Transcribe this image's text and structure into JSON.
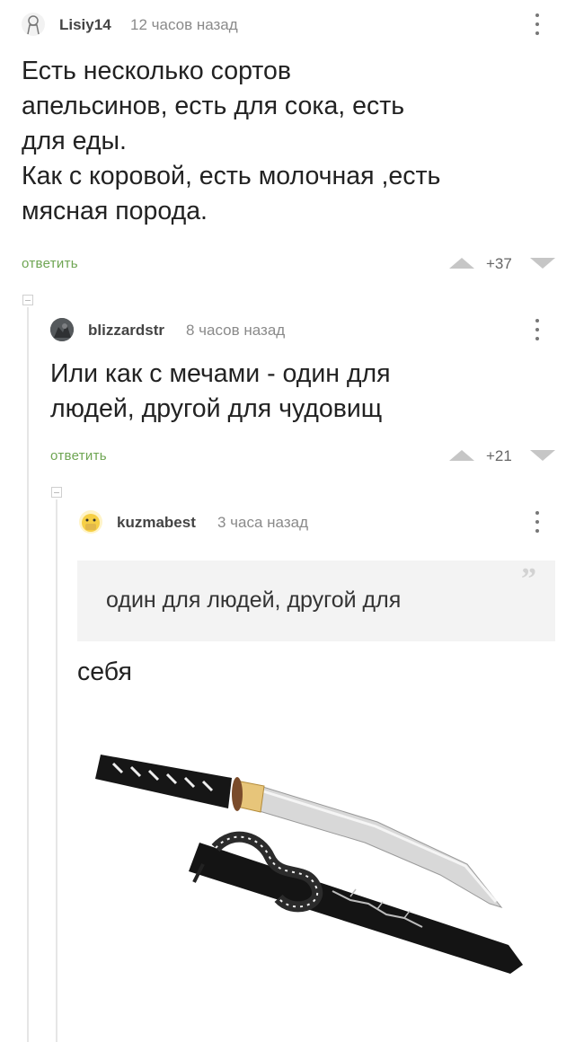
{
  "comments": [
    {
      "author": "Lisiy14",
      "time": "12 часов назад",
      "lines": [
        "Есть несколько сортов",
        "апельсинов, есть для сока, есть",
        "для еды.",
        "Как с коровой, есть молочная ,есть",
        "мясная порода."
      ],
      "reply_label": "ответить",
      "rating": "+37"
    },
    {
      "author": "blizzardstr",
      "time": "8 часов назад",
      "lines": [
        "Или как с мечами - один для",
        "людей, другой для чудовищ"
      ],
      "reply_label": "ответить",
      "rating": "+21"
    },
    {
      "author": "kuzmabest",
      "time": "3 часа назад",
      "quote": "один для людей, другой для",
      "text": "себя",
      "image_subject": "tanto-sword-with-scabbard"
    }
  ],
  "colors": {
    "reply_green": "#6ea552",
    "thread_line": "#e6e6e6",
    "quote_bg": "#f3f3f3"
  },
  "icons": [
    "kebab-menu-icon",
    "upvote-icon",
    "downvote-icon",
    "quote-marks-icon",
    "collapse-toggle-icon"
  ]
}
